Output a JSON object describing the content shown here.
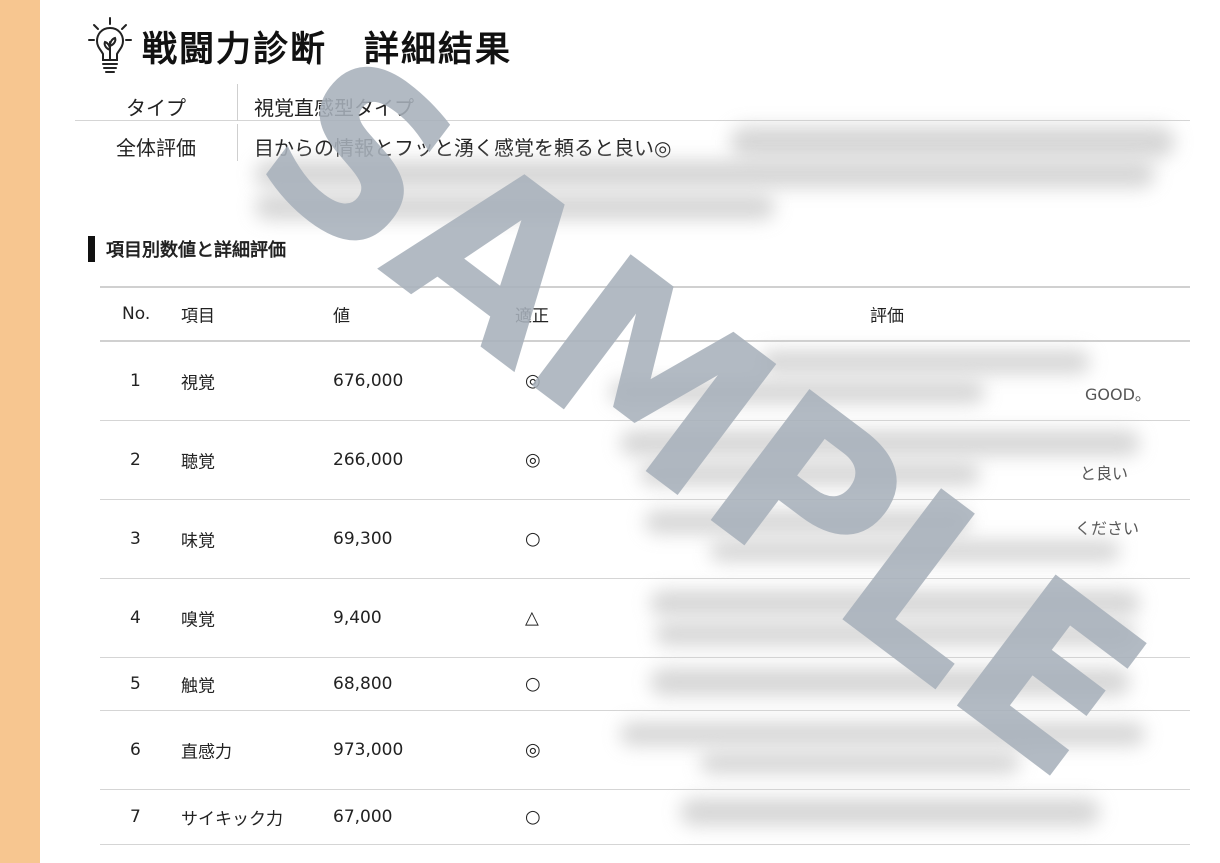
{
  "page": {
    "title": "戦闘力診断　詳細結果"
  },
  "summary": {
    "type_label": "タイプ",
    "type_value": "視覚直感型タイプ",
    "overall_label": "全体評価",
    "overall_value": "目からの情報とフッと湧く感覚を頼ると良い◎"
  },
  "section": {
    "title": "項目別数値と詳細評価"
  },
  "table": {
    "headers": {
      "no": "No.",
      "item": "項目",
      "value": "値",
      "proper": "適正",
      "eval": "評価"
    },
    "rows": [
      {
        "no": "1",
        "item": "視覚",
        "value": "676,000",
        "proper": "◎",
        "eval_snippet": "GOOD。"
      },
      {
        "no": "2",
        "item": "聴覚",
        "value": "266,000",
        "proper": "◎",
        "eval_snippet": "と良い"
      },
      {
        "no": "3",
        "item": "味覚",
        "value": "69,300",
        "proper": "○",
        "eval_snippet": "ください"
      },
      {
        "no": "4",
        "item": "嗅覚",
        "value": "9,400",
        "proper": "△",
        "eval_snippet": ""
      },
      {
        "no": "5",
        "item": "触覚",
        "value": "68,800",
        "proper": "○",
        "eval_snippet": ""
      },
      {
        "no": "6",
        "item": "直感力",
        "value": "973,000",
        "proper": "◎",
        "eval_snippet": ""
      },
      {
        "no": "7",
        "item": "サイキック力",
        "value": "67,000",
        "proper": "○",
        "eval_snippet": ""
      }
    ]
  },
  "watermark": {
    "text": "SAMPLE",
    "color": "#a7b1bb"
  },
  "colors": {
    "side_bar": "#f7c690"
  }
}
